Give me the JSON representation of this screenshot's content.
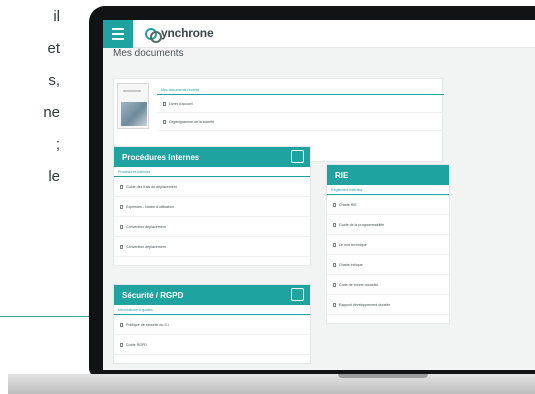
{
  "left_text_fragments": [
    "il",
    "et",
    "s,",
    "ne",
    ";",
    "le"
  ],
  "app": {
    "logo_text": "ynchrone",
    "page_title": "Mes documents"
  },
  "documents_card": {
    "subhead": "Mes documents récents",
    "items": [
      "Livret d'accueil",
      "Organigramme de la société"
    ]
  },
  "procedures_card": {
    "title": "Procédures Internes",
    "subhead": "Procédures internes",
    "items": [
      "Guide des frais de déplacement",
      "Expenses - Notice d'utilisation",
      "Convention déplacement",
      "Convention déplacement"
    ]
  },
  "rie_card": {
    "title": "RIE",
    "subhead": "Règlement Intérieur",
    "items": [
      "Charte RIE",
      "Guide de la programmabilité",
      "Le mot technique",
      "Charte éthique",
      "Code de bonne conduite",
      "Rapport développement durable"
    ]
  },
  "security_card": {
    "title": "Sécurité / RGPD",
    "subhead": "Informations & guides",
    "items": [
      "Politique de sécurité du S.I.",
      "Guide RGPD"
    ]
  },
  "colors": {
    "accent": "#1fa3a0",
    "frame": "#111315",
    "screen_bg": "#f2f4f4"
  }
}
